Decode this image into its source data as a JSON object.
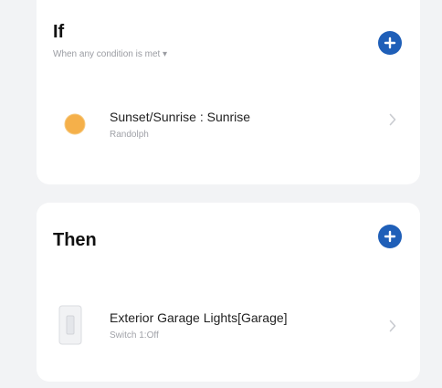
{
  "if_section": {
    "title": "If",
    "subtitle": "When any condition is met ▾",
    "add_icon": "plus-circle-icon",
    "condition": {
      "icon": "sun-icon",
      "title": "Sunset/Sunrise : Sunrise",
      "subtitle": "Randolph"
    }
  },
  "then_section": {
    "title": "Then",
    "add_icon": "plus-circle-icon",
    "action": {
      "icon": "wall-switch-icon",
      "title": "Exterior Garage Lights[Garage]",
      "subtitle": "Switch 1:Off"
    }
  },
  "colors": {
    "accent": "#1f5fb8",
    "sun": "#f5b04a",
    "page_bg": "#f2f3f5",
    "card_bg": "#ffffff"
  }
}
